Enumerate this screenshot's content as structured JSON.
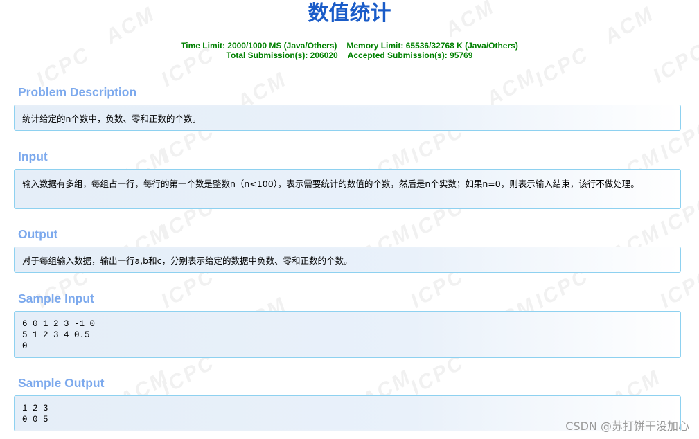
{
  "problem": {
    "title": "数值统计",
    "limits": {
      "time": "Time Limit: 2000/1000 MS (Java/Others)",
      "memory": "Memory Limit: 65536/32768 K (Java/Others)",
      "total_submissions": "Total Submission(s): 206020",
      "accepted_submissions": "Accepted Submission(s): 95769"
    },
    "sections": {
      "description": {
        "heading": "Problem Description",
        "body": "统计给定的n个数中，负数、零和正数的个数。"
      },
      "input": {
        "heading": "Input",
        "body": "输入数据有多组，每组占一行，每行的第一个数是整数n（n<100），表示需要统计的数值的个数，然后是n个实数；如果n=0，则表示输入结束，该行不做处理。"
      },
      "output": {
        "heading": "Output",
        "body": "对于每组输入数据，输出一行a,b和c，分别表示给定的数据中负数、零和正数的个数。"
      },
      "sample_input": {
        "heading": "Sample Input",
        "lines": [
          "6 0 1 2 3 -1 0",
          "5 1 2 3 4 0.5",
          "0"
        ]
      },
      "sample_output": {
        "heading": "Sample Output",
        "lines": [
          "1 2 3",
          "0 0 5"
        ]
      }
    }
  },
  "watermark": {
    "acm": "ACM",
    "icpc": "ICPC",
    "color": "#f1f1f1"
  },
  "footer": {
    "csdn_watermark": "CSDN @苏打饼干没加心"
  },
  "colors": {
    "title": "#1a5cc8",
    "limits": "#008000",
    "section_heading": "#7ca9ed",
    "box_border": "#8ed1f0"
  }
}
